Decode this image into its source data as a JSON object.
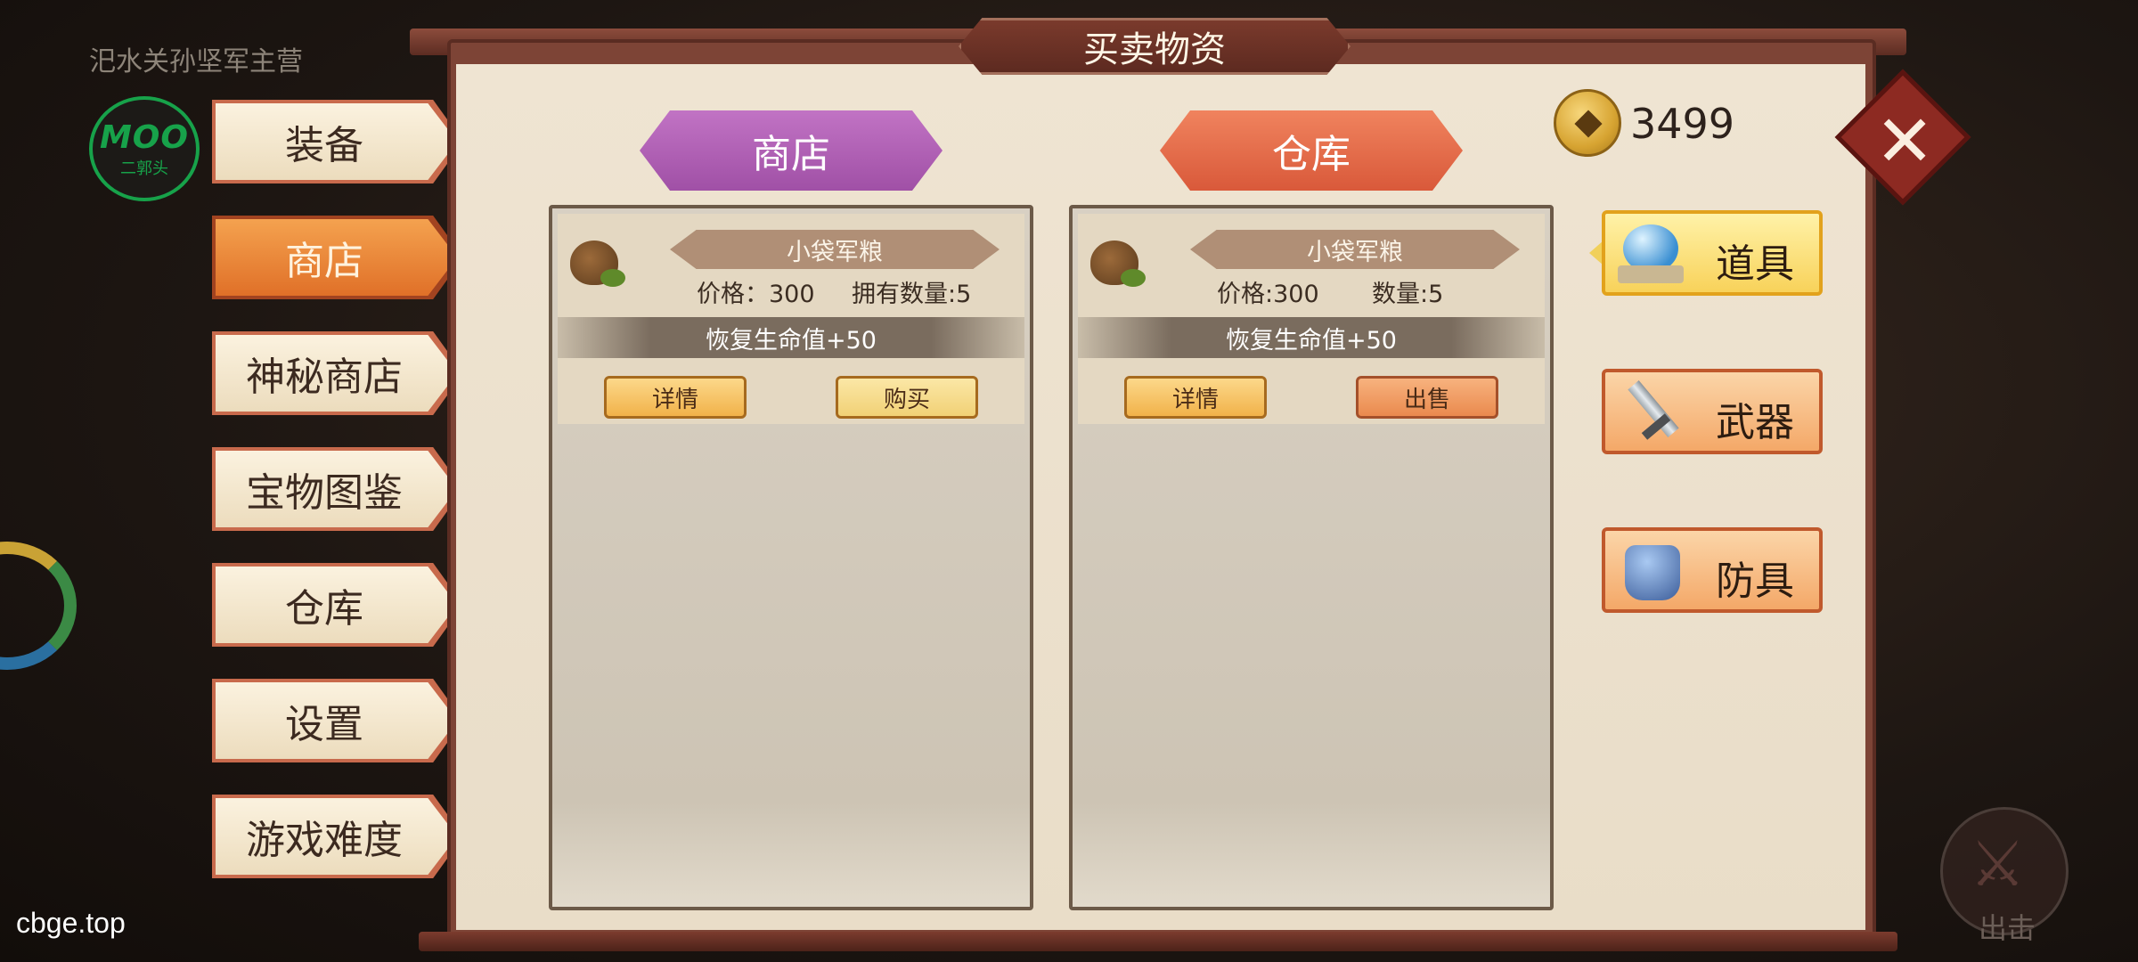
{
  "scene": {
    "location_title": "汜水关孙坚军主营",
    "logo": {
      "main": "MOO",
      "sub": "二郭头"
    },
    "watermark": "cbge.top",
    "attack_label": "出击"
  },
  "menu": {
    "items": [
      {
        "label": "装备",
        "active": false
      },
      {
        "label": "商店",
        "active": true
      },
      {
        "label": "神秘商店",
        "active": false
      },
      {
        "label": "宝物图鉴",
        "active": false
      },
      {
        "label": "仓库",
        "active": false
      },
      {
        "label": "设置",
        "active": false
      },
      {
        "label": "游戏难度",
        "active": false
      }
    ]
  },
  "panel": {
    "title": "买卖物资",
    "shop_tab": "商店",
    "warehouse_tab": "仓库",
    "coins": "3499",
    "close_glyph": "✕"
  },
  "shop": {
    "items": [
      {
        "name": "小袋军粮",
        "price": "价格：300",
        "owned": "拥有数量:5",
        "effect": "恢复生命值+50",
        "detail_label": "详情",
        "action_label": "购买"
      }
    ]
  },
  "warehouse": {
    "items": [
      {
        "name": "小袋军粮",
        "price": "价格:300",
        "owned": "数量:5",
        "effect": "恢复生命值+50",
        "detail_label": "详情",
        "action_label": "出售"
      }
    ]
  },
  "categories": [
    {
      "label": "道具",
      "icon": "orb-icon",
      "active": true
    },
    {
      "label": "武器",
      "icon": "sword-icon",
      "active": false
    },
    {
      "label": "防具",
      "icon": "armor-icon",
      "active": false
    }
  ],
  "colors": {
    "active_menu": "#e07028",
    "shop_tab": "#a050a6",
    "warehouse_tab": "#d9593a",
    "panel_frame": "#7d4436"
  }
}
